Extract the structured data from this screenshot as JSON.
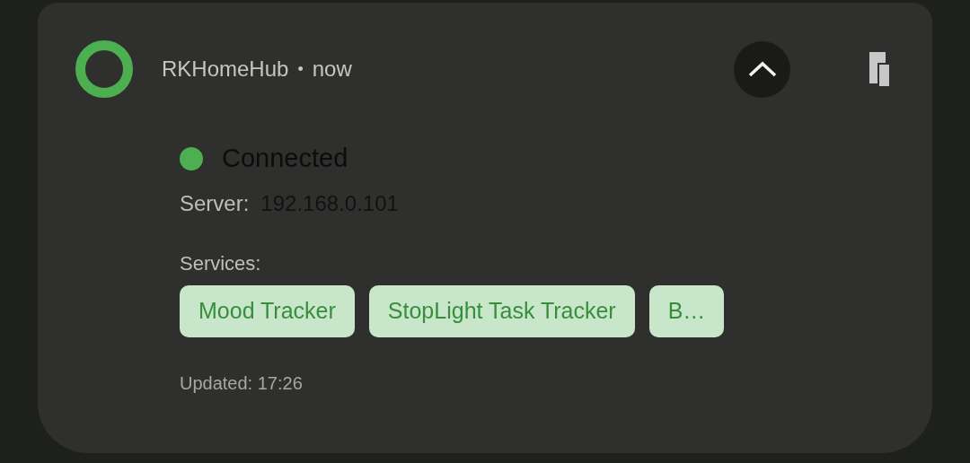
{
  "notification": {
    "app_name": "RKHomeHub",
    "separator": "•",
    "time": "now",
    "expanded": true
  },
  "status": {
    "label": "Connected",
    "color": "#4caf50"
  },
  "server": {
    "label": "Server:",
    "value": "192.168.0.101"
  },
  "services": {
    "label": "Services:",
    "items": [
      {
        "label": "Mood Tracker"
      },
      {
        "label": "StopLight Task Tracker"
      },
      {
        "label": "B…"
      }
    ]
  },
  "updated": "Updated: 17:26"
}
